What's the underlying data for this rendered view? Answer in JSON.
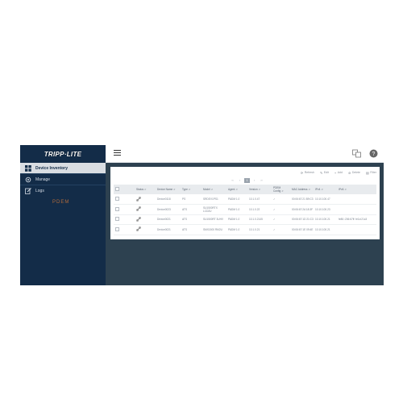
{
  "brand": {
    "logo_text": "TRIPP·LITE",
    "sub_mark": "PDEM"
  },
  "sidebar": {
    "items": [
      {
        "label": "Device Inventory",
        "icon": "grid-icon",
        "active": true
      },
      {
        "label": "Manage",
        "icon": "gear-icon",
        "active": false
      },
      {
        "label": "Logs",
        "icon": "log-edit-icon",
        "active": false
      }
    ]
  },
  "topbar": {
    "menu_icon": "hamburger-icon",
    "icons": [
      "language-icon",
      "help-icon",
      "user-icon"
    ]
  },
  "toolbar": [
    {
      "label": "Refresh",
      "icon": "refresh-icon",
      "glyph": "⟳"
    },
    {
      "label": "Edit",
      "icon": "edit-icon",
      "glyph": "✎"
    },
    {
      "label": "Add",
      "icon": "add-icon",
      "glyph": "+"
    },
    {
      "label": "Delete",
      "icon": "delete-icon",
      "glyph": "⊘"
    },
    {
      "label": "Filter",
      "icon": "filter-icon",
      "glyph": "▤"
    }
  ],
  "pager": {
    "prev": "‹‹",
    "prev_one": "‹",
    "current": "1",
    "next_one": "›",
    "next": "››"
  },
  "table": {
    "columns": [
      "Status",
      "Device Name",
      "Type",
      "Model",
      "Agent",
      "Version",
      "PDEM Config",
      "MAC Address",
      "IPv4",
      "IPv6"
    ],
    "rows": [
      {
        "status_icon": "link-icon",
        "name": "Device0118",
        "type": "PS",
        "model": "SRDEV1PS1",
        "agent": "PADM 1.0",
        "version": "10.1.0.47",
        "config": "✓",
        "mac": "00:06:67:21 B9:C3",
        "ipv4": "10.10.100.47",
        "ipv6": ""
      },
      {
        "status_icon": "link-icon",
        "name": "Device0023",
        "type": "ATS",
        "model": "SU1500RTX LCD2U",
        "agent": "PADM 1.0",
        "version": "10.1.0.22",
        "config": "✓",
        "mac": "00:06:67:2A 18:3F",
        "ipv4": "10.10.100.23",
        "ipv6": ""
      },
      {
        "status_icon": "link-icon",
        "name": "Device0021",
        "type": "ATS",
        "model": "SU1500RT 3UHV",
        "agent": "PADM 1.0",
        "version": "10.1.0.2145",
        "config": "✓",
        "mac": "00:06:67:1D 21:C3",
        "ipv4": "10.10.100.21",
        "ipv6": "fe80::206:67ff: fe1d:21c3"
      },
      {
        "status_icon": "link-icon",
        "name": "Device0021",
        "type": "ATS",
        "model": "SMX1500 RM2U",
        "agent": "PADM 1.0",
        "version": "10.1.0.21",
        "config": "✓",
        "mac": "00:06:67:1E 09:4E",
        "ipv4": "10.10.100.21",
        "ipv6": ""
      }
    ]
  },
  "colors": {
    "sidebar_bg": "#132c48",
    "content_bg": "#2d4150",
    "active_item_bg": "#d9dde2",
    "brand_mark": "#b36b3a"
  }
}
